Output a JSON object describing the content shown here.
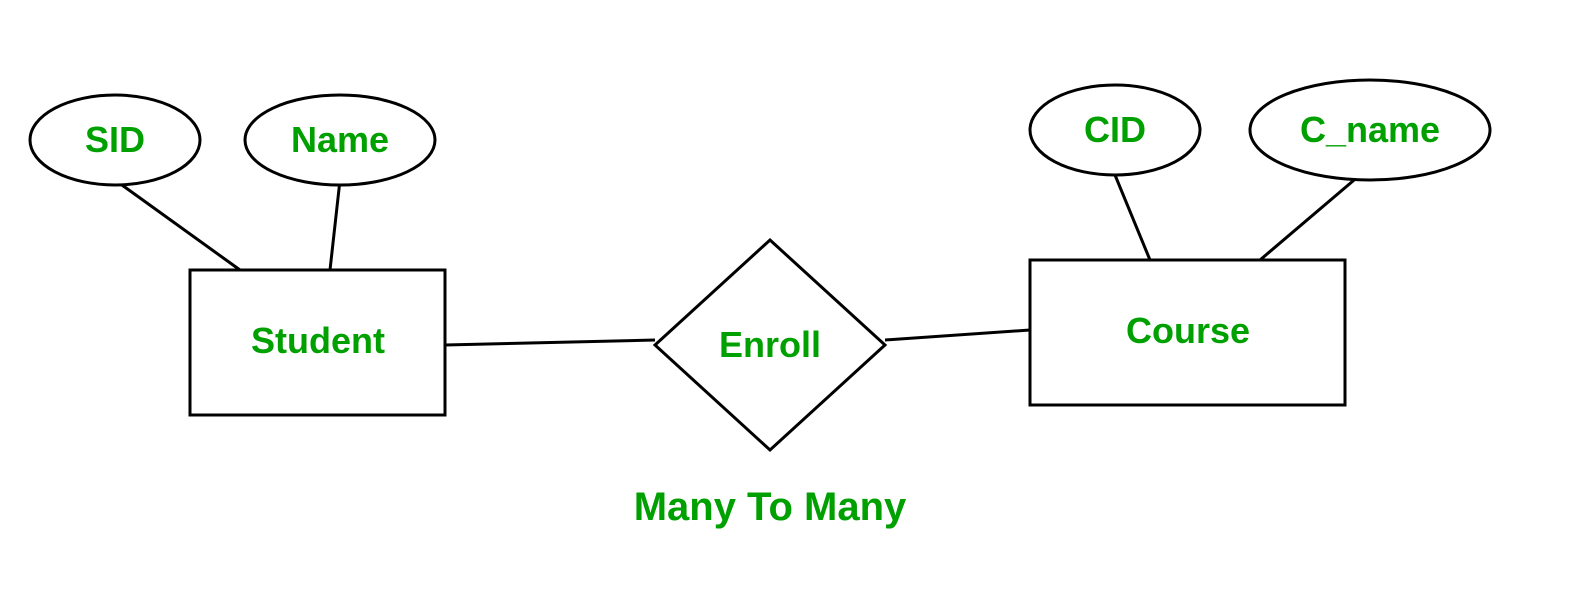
{
  "entities": {
    "student": {
      "label": "Student",
      "attributes": {
        "sid": "SID",
        "name": "Name"
      }
    },
    "course": {
      "label": "Course",
      "attributes": {
        "cid": "CID",
        "cname": "C_name"
      }
    }
  },
  "relationship": {
    "enroll": "Enroll"
  },
  "caption": "Many To Many"
}
